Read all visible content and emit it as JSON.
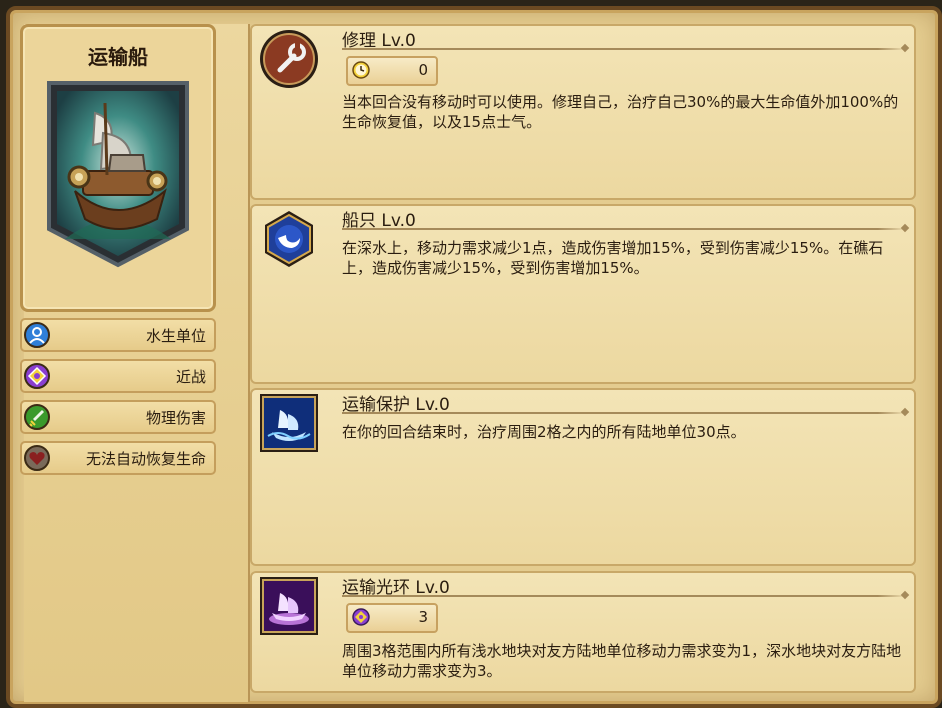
{
  "unit": {
    "name": "运输船",
    "tags": [
      {
        "label": "水生单位",
        "icon": "person-icon",
        "color": "#2f7fd8"
      },
      {
        "label": "近战",
        "icon": "diamond-icon",
        "color": "#8a3fd0"
      },
      {
        "label": "物理伤害",
        "icon": "sword-icon",
        "color": "#3a9a2c"
      },
      {
        "label": "无法自动恢复生命",
        "icon": "heart-icon",
        "color": "#8a2020"
      }
    ]
  },
  "skills": [
    {
      "title": "修理 Lv.0",
      "icon": "wrench-icon",
      "cost": {
        "icon": "clock-icon",
        "value": "0"
      },
      "desc": "当本回合没有移动时可以使用。修理自己，治疗自己30%的最大生命值外加100%的生命恢复值，以及15点士气。"
    },
    {
      "title": "船只 Lv.0",
      "icon": "ship-wave-icon",
      "desc": "在深水上，移动力需求减少1点，造成伤害增加15%，受到伤害减少15%。在礁石上，造成伤害减少15%，受到伤害增加15%。"
    },
    {
      "title": "运输保护 Lv.0",
      "icon": "transport-protect-icon",
      "desc": "在你的回合结束时，治疗周围2格之内的所有陆地单位30点。"
    },
    {
      "title": "运输光环 Lv.0",
      "icon": "transport-aura-icon",
      "cost": {
        "icon": "diamond-icon",
        "value": "3"
      },
      "desc": "周围3格范围内所有浅水地块对友方陆地单位移动力需求变为1，深水地块对友方陆地单位移动力需求变为3。"
    }
  ]
}
